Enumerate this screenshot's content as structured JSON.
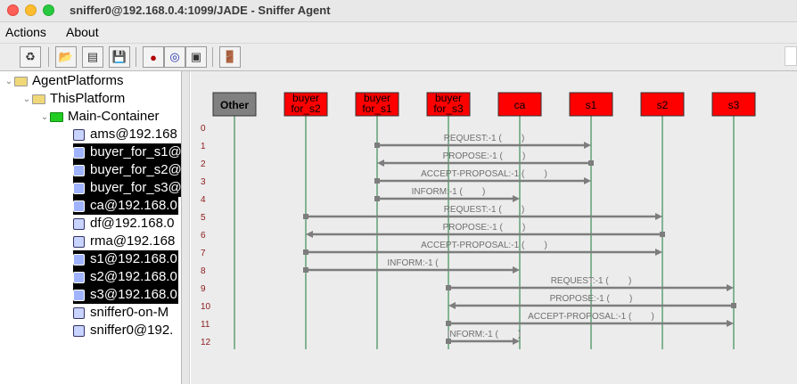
{
  "window": {
    "title": "sniffer0@192.168.0.4:1099/JADE - Sniffer Agent"
  },
  "menu": {
    "items": [
      "Actions",
      "About"
    ]
  },
  "toolbar": {
    "buttons": [
      {
        "name": "clear-canvas-button",
        "icon": "recycle-icon",
        "glyph": "♻"
      },
      {
        "name": "open-file-button",
        "icon": "folder-open-icon",
        "glyph": "📂"
      },
      {
        "name": "display-log-button",
        "icon": "document-icon",
        "glyph": "▤"
      },
      {
        "name": "save-file-button",
        "icon": "floppy-disk-icon",
        "glyph": "💾"
      },
      {
        "name": "sniff-on-button",
        "icon": "record-icon",
        "glyph": "●"
      },
      {
        "name": "sniff-off-button",
        "icon": "spiral-icon",
        "glyph": "◎"
      },
      {
        "name": "filter-button",
        "icon": "square-target-icon",
        "glyph": "▣"
      },
      {
        "name": "exit-button",
        "icon": "exit-door-icon",
        "glyph": "🚪"
      }
    ]
  },
  "tree": {
    "nodes": [
      {
        "label": "AgentPlatforms",
        "kind": "folder",
        "level": 0,
        "selected": false
      },
      {
        "label": "ThisPlatform",
        "kind": "folder",
        "level": 1,
        "selected": false
      },
      {
        "label": "Main-Container",
        "kind": "container",
        "level": 2,
        "selected": false
      },
      {
        "label": "ams@192.168",
        "kind": "agent",
        "level": 3,
        "selected": false
      },
      {
        "label": "buyer_for_s1@",
        "kind": "agent",
        "level": 3,
        "selected": true
      },
      {
        "label": "buyer_for_s2@",
        "kind": "agent",
        "level": 3,
        "selected": true
      },
      {
        "label": "buyer_for_s3@",
        "kind": "agent",
        "level": 3,
        "selected": true
      },
      {
        "label": "ca@192.168.0",
        "kind": "agent",
        "level": 3,
        "selected": true
      },
      {
        "label": "df@192.168.0",
        "kind": "agent",
        "level": 3,
        "selected": false
      },
      {
        "label": "rma@192.168",
        "kind": "agent",
        "level": 3,
        "selected": false
      },
      {
        "label": "s1@192.168.0",
        "kind": "agent",
        "level": 3,
        "selected": true
      },
      {
        "label": "s2@192.168.0",
        "kind": "agent",
        "level": 3,
        "selected": true
      },
      {
        "label": "s3@192.168.0",
        "kind": "agent",
        "level": 3,
        "selected": true
      },
      {
        "label": "sniffer0-on-M",
        "kind": "agent",
        "level": 3,
        "selected": false
      },
      {
        "label": "sniffer0@192.",
        "kind": "agent",
        "level": 3,
        "selected": false
      }
    ]
  },
  "sniffer": {
    "agents": [
      {
        "lines": [
          "Other"
        ],
        "color": "#808080"
      },
      {
        "lines": [
          "buyer",
          "for_s2"
        ],
        "color": "#ff0000"
      },
      {
        "lines": [
          "buyer",
          "for_s1"
        ],
        "color": "#ff0000"
      },
      {
        "lines": [
          "buyer",
          "for_s3"
        ],
        "color": "#ff0000"
      },
      {
        "lines": [
          "ca"
        ],
        "color": "#ff0000"
      },
      {
        "lines": [
          "s1"
        ],
        "color": "#ff0000"
      },
      {
        "lines": [
          "s2"
        ],
        "color": "#ff0000"
      },
      {
        "lines": [
          "s3"
        ],
        "color": "#ff0000"
      }
    ],
    "row_numbers": [
      "0",
      "1",
      "2",
      "3",
      "4",
      "5",
      "6",
      "7",
      "8",
      "9",
      "10",
      "11",
      "12"
    ],
    "messages": [
      {
        "row": 1,
        "from": 2,
        "to": 5,
        "label": "REQUEST:-1 (        )"
      },
      {
        "row": 2,
        "from": 5,
        "to": 2,
        "label": "PROPOSE:-1 (        )"
      },
      {
        "row": 3,
        "from": 2,
        "to": 5,
        "label": "ACCEPT-PROPOSAL:-1 (        )"
      },
      {
        "row": 4,
        "from": 2,
        "to": 4,
        "label": "INFORM:-1 (        )"
      },
      {
        "row": 5,
        "from": 1,
        "to": 6,
        "label": "REQUEST:-1 (        )"
      },
      {
        "row": 6,
        "from": 6,
        "to": 1,
        "label": "PROPOSE:-1 (        )"
      },
      {
        "row": 7,
        "from": 1,
        "to": 6,
        "label": "ACCEPT-PROPOSAL:-1 (        )"
      },
      {
        "row": 8,
        "from": 1,
        "to": 4,
        "label": "INFORM:-1 ("
      },
      {
        "row": 9,
        "from": 3,
        "to": 7,
        "label": "REQUEST:-1 (        )"
      },
      {
        "row": 10,
        "from": 7,
        "to": 3,
        "label": "PROPOSE:-1 (        )"
      },
      {
        "row": 11,
        "from": 3,
        "to": 7,
        "label": "ACCEPT-PROPOSAL:-1 (        )"
      },
      {
        "row": 12,
        "from": 3,
        "to": 4,
        "label": "INFORM:-1 (        )"
      }
    ],
    "colors": {
      "lifeline": "#1a7a3a",
      "arrow": "#7d7d7d",
      "row_number": "#8b1a1a",
      "label": "#6e6e6e"
    }
  }
}
